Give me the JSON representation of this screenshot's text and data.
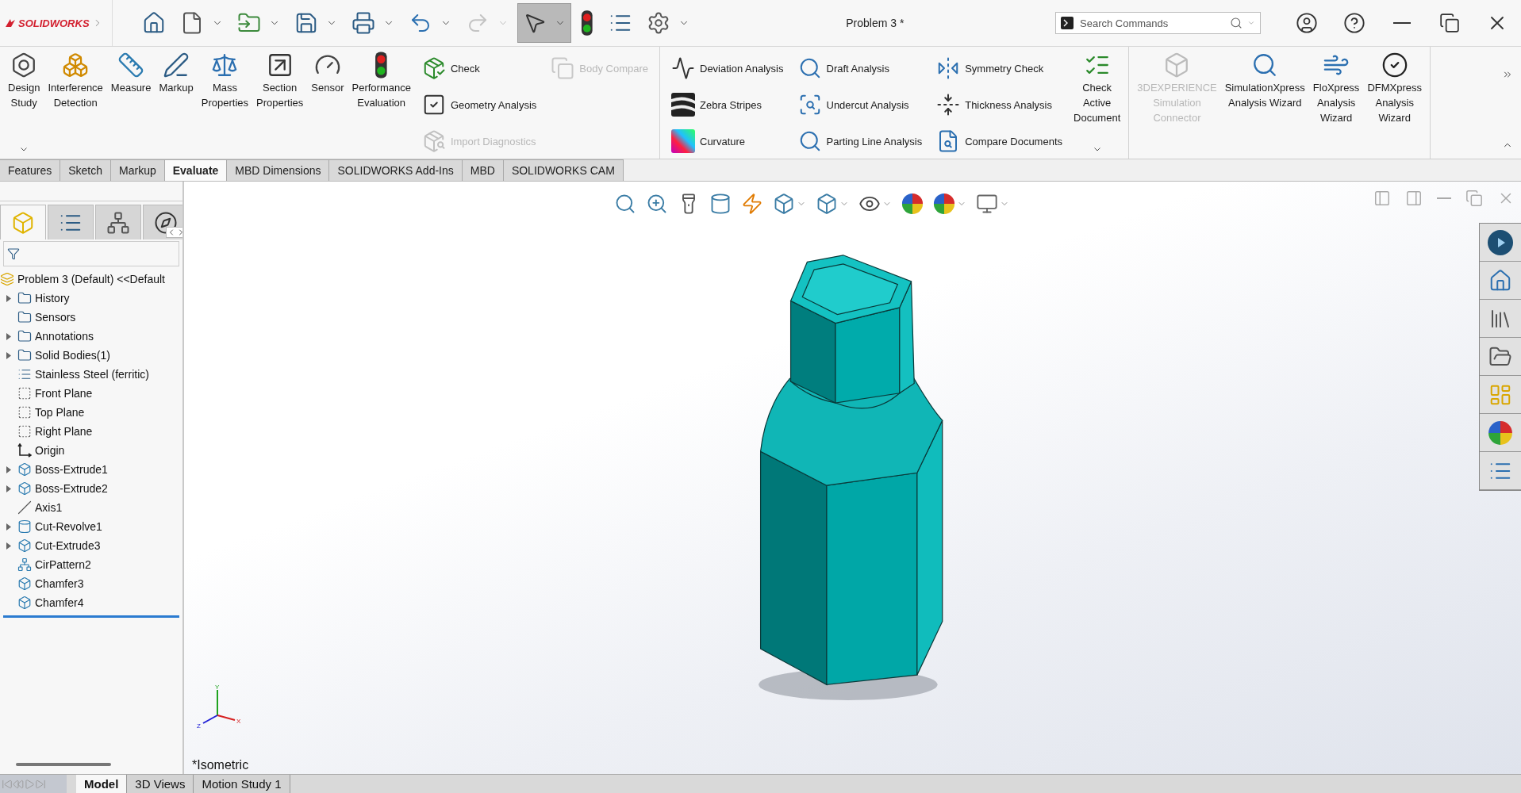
{
  "app": {
    "logo": "SOLIDWORKS",
    "title": "Problem 3 *"
  },
  "quick_tools": [
    {
      "selected": false,
      "disabled": false,
      "dropdown": false
    },
    {
      "selected": false,
      "disabled": false,
      "dropdown": true
    },
    {
      "selected": false,
      "disabled": false,
      "dropdown": true
    },
    {
      "selected": false,
      "disabled": false,
      "dropdown": true
    },
    {
      "selected": false,
      "disabled": false,
      "dropdown": true
    },
    {
      "selected": false,
      "disabled": false,
      "dropdown": true
    },
    {
      "selected": false,
      "disabled": true,
      "dropdown": true
    },
    {
      "selected": true,
      "disabled": false,
      "dropdown": true
    },
    {
      "selected": false,
      "disabled": false,
      "dropdown": false
    },
    {
      "selected": false,
      "disabled": false,
      "dropdown": false
    },
    {
      "selected": false,
      "disabled": false,
      "dropdown": true
    }
  ],
  "search": {
    "placeholder": "Search Commands"
  },
  "ribbon": {
    "groups": [
      {
        "items": [
          {
            "kind": "large",
            "label": "Design\nStudy",
            "disabled": false,
            "dropdown": true
          },
          {
            "kind": "large",
            "label": "Interference\nDetection",
            "disabled": false,
            "dropdown": false
          },
          {
            "kind": "large",
            "label": "Measure",
            "disabled": false,
            "dropdown": false
          },
          {
            "kind": "large",
            "label": "Markup",
            "disabled": false,
            "dropdown": false
          },
          {
            "kind": "large",
            "label": "Mass\nProperties",
            "disabled": false,
            "dropdown": false
          },
          {
            "kind": "large",
            "label": "Section\nProperties",
            "disabled": false,
            "dropdown": false
          },
          {
            "kind": "large",
            "label": "Sensor",
            "disabled": false,
            "dropdown": false
          },
          {
            "kind": "large",
            "label": "Performance\nEvaluation",
            "disabled": false,
            "dropdown": false
          },
          {
            "kind": "column",
            "entries": [
              {
                "label": "Check",
                "disabled": false
              },
              {
                "label": "Geometry Analysis",
                "disabled": false
              },
              {
                "label": "Import Diagnostics",
                "disabled": true
              }
            ]
          },
          {
            "kind": "column",
            "entries": [
              {
                "label": "Body Compare",
                "disabled": true
              }
            ]
          }
        ]
      },
      {
        "items": [
          {
            "kind": "column",
            "entries": [
              {
                "label": "Deviation Analysis",
                "disabled": false
              },
              {
                "label": "Zebra Stripes",
                "disabled": false
              },
              {
                "label": "Curvature",
                "disabled": false
              }
            ]
          },
          {
            "kind": "column",
            "entries": [
              {
                "label": "Draft Analysis",
                "disabled": false
              },
              {
                "label": "Undercut Analysis",
                "disabled": false
              },
              {
                "label": "Parting Line Analysis",
                "disabled": false
              }
            ]
          },
          {
            "kind": "column",
            "entries": [
              {
                "label": "Symmetry Check",
                "disabled": false
              },
              {
                "label": "Thickness Analysis",
                "disabled": false
              },
              {
                "label": "Compare Documents",
                "disabled": false
              }
            ]
          },
          {
            "kind": "large",
            "label": "Check\nActive\nDocument",
            "disabled": false,
            "dropdown": true
          }
        ]
      },
      {
        "items": [
          {
            "kind": "large",
            "label": "3DEXPERIENCE\nSimulation\nConnector",
            "disabled": true,
            "dropdown": false
          },
          {
            "kind": "large",
            "label": "SimulationXpress\nAnalysis Wizard",
            "disabled": false,
            "dropdown": false
          },
          {
            "kind": "large",
            "label": "FloXpress\nAnalysis\nWizard",
            "disabled": false,
            "dropdown": false
          },
          {
            "kind": "large",
            "label": "DFMXpress\nAnalysis\nWizard",
            "disabled": false,
            "dropdown": false
          }
        ]
      }
    ]
  },
  "command_tabs": [
    {
      "label": "Features",
      "selected": false
    },
    {
      "label": "Sketch",
      "selected": false
    },
    {
      "label": "Markup",
      "selected": false
    },
    {
      "label": "Evaluate",
      "selected": true
    },
    {
      "label": "MBD Dimensions",
      "selected": false
    },
    {
      "label": "SOLIDWORKS Add-Ins",
      "selected": false
    },
    {
      "label": "MBD",
      "selected": false
    },
    {
      "label": "SOLIDWORKS CAM",
      "selected": false
    }
  ],
  "panel_tabs": [
    {
      "selected": true
    },
    {
      "selected": false
    },
    {
      "selected": false
    },
    {
      "selected": false
    }
  ],
  "feature_tree": {
    "root": {
      "label": "Problem 3 (Default) <<Default",
      "children": [
        {
          "label": "History",
          "collapsed": true
        },
        {
          "label": "Sensors",
          "collapsed": false
        },
        {
          "label": "Annotations",
          "collapsed": true
        },
        {
          "label": "Solid Bodies(1)",
          "collapsed": true
        },
        {
          "label": "Stainless Steel (ferritic)",
          "collapsed": false
        },
        {
          "label": "Front Plane",
          "collapsed": false
        },
        {
          "label": "Top Plane",
          "collapsed": false
        },
        {
          "label": "Right Plane",
          "collapsed": false
        },
        {
          "label": "Origin",
          "collapsed": false
        },
        {
          "label": "Boss-Extrude1",
          "collapsed": true
        },
        {
          "label": "Boss-Extrude2",
          "collapsed": true
        },
        {
          "label": "Axis1",
          "collapsed": false
        },
        {
          "label": "Cut-Revolve1",
          "collapsed": true
        },
        {
          "label": "Cut-Extrude3",
          "collapsed": true
        },
        {
          "label": "CirPattern2",
          "collapsed": false
        },
        {
          "label": "Chamfer3",
          "collapsed": false
        },
        {
          "label": "Chamfer4",
          "collapsed": false
        }
      ]
    }
  },
  "viewport": {
    "view_name": "*Isometric",
    "triad": {
      "x": "X",
      "y": "Y",
      "z": "Z"
    }
  },
  "bottom_tabs": [
    {
      "label": "Model",
      "selected": true
    },
    {
      "label": "3D Views",
      "selected": false
    },
    {
      "label": "Motion Study 1",
      "selected": false
    }
  ]
}
